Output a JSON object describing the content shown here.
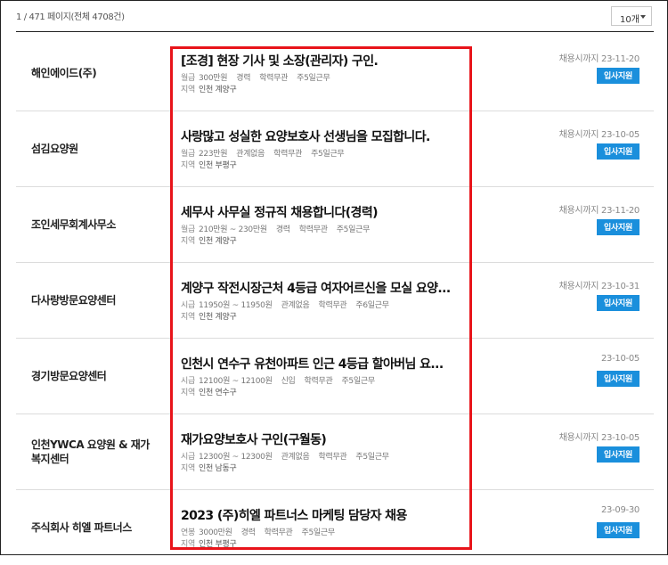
{
  "header": {
    "page_info": "1 / 471 페이지(전체 4708건)",
    "per_page": "10개"
  },
  "jobs": [
    {
      "company": "해인에이드(주)",
      "title": "[조경] 현장 기사 및 소장(관리자) 구인.",
      "pay_type": "월급",
      "pay": "300만원",
      "career": "경력",
      "education": "학력무관",
      "schedule": "주5일근무",
      "region_label": "지역",
      "region": "인천 계양구",
      "deadline": "채용시까지 23-11-20",
      "apply": "입사지원"
    },
    {
      "company": "섬김요양원",
      "title": "사랑많고 성실한 요양보호사 선생님을 모집합니다.",
      "pay_type": "월급",
      "pay": "223만원",
      "career": "관계없음",
      "education": "학력무관",
      "schedule": "주5일근무",
      "region_label": "지역",
      "region": "인천 부평구",
      "deadline": "채용시까지 23-10-05",
      "apply": "입사지원"
    },
    {
      "company": "조인세무회계사무소",
      "title": "세무사 사무실 정규직 채용합니다(경력)",
      "pay_type": "월급",
      "pay": "210만원 ~ 230만원",
      "career": "경력",
      "education": "학력무관",
      "schedule": "주5일근무",
      "region_label": "지역",
      "region": "인천 계양구",
      "deadline": "채용시까지 23-11-20",
      "apply": "입사지원"
    },
    {
      "company": "다사랑방문요양센터",
      "title": "계양구 작전시장근처 4등급 여자어르신을 모실 요양...",
      "pay_type": "시급",
      "pay": "11950원 ~ 11950원",
      "career": "관계없음",
      "education": "학력무관",
      "schedule": "주6일근무",
      "region_label": "지역",
      "region": "인천 계양구",
      "deadline": "채용시까지 23-10-31",
      "apply": "입사지원"
    },
    {
      "company": "경기방문요양센터",
      "title": "인천시 연수구 유천아파트 인근 4등급 할아버님 요...",
      "pay_type": "시급",
      "pay": "12100원 ~ 12100원",
      "career": "신입",
      "education": "학력무관",
      "schedule": "주5일근무",
      "region_label": "지역",
      "region": "인천 연수구",
      "deadline": "23-10-05",
      "apply": "입사지원"
    },
    {
      "company": "인천YWCA 요양원 & 재가복지센터",
      "title": "재가요양보호사 구인(구월동)",
      "pay_type": "시급",
      "pay": "12300원 ~ 12300원",
      "career": "관계없음",
      "education": "학력무관",
      "schedule": "주5일근무",
      "region_label": "지역",
      "region": "인천 남동구",
      "deadline": "채용시까지 23-10-05",
      "apply": "입사지원"
    },
    {
      "company": "주식회사 히엘 파트너스",
      "title": "2023 (주)히엘 파트너스 마케팅 담당자 채용",
      "pay_type": "연봉",
      "pay": "3000만원",
      "career": "경력",
      "education": "학력무관",
      "schedule": "주5일근무",
      "region_label": "지역",
      "region": "인천 부평구",
      "deadline": "23-09-30",
      "apply": "입사지원"
    }
  ],
  "colors": {
    "accent": "#1a8fdc",
    "highlight": "#e8141a"
  }
}
